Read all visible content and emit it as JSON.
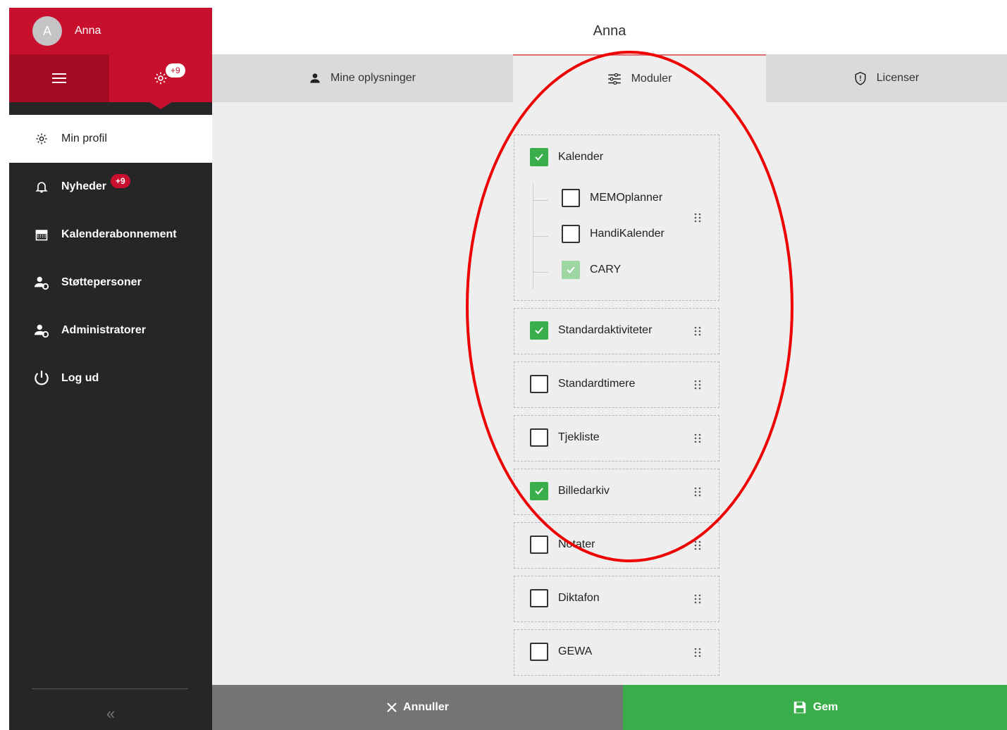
{
  "user": {
    "initial": "A",
    "name": "Anna"
  },
  "header": {
    "settings_badge": "+9",
    "title": "Anna"
  },
  "sidebar": {
    "items": [
      {
        "label": "Min profil",
        "icon": "gear-icon"
      },
      {
        "label": "Nyheder",
        "icon": "bell-icon",
        "badge": "+9"
      },
      {
        "label": "Kalenderabonnement",
        "icon": "calendar-icon"
      },
      {
        "label": "Støttepersoner",
        "icon": "person-gear-icon"
      },
      {
        "label": "Administratorer",
        "icon": "person-gear-icon"
      },
      {
        "label": "Log ud",
        "icon": "power-icon"
      }
    ],
    "collapse_glyph": "«"
  },
  "tabs": [
    {
      "label": "Mine oplysninger",
      "icon": "person-icon"
    },
    {
      "label": "Moduler",
      "icon": "sliders-icon"
    },
    {
      "label": "Licenser",
      "icon": "shield-icon"
    }
  ],
  "modules": {
    "kalender": {
      "label": "Kalender",
      "checked": true,
      "children": [
        {
          "label": "MEMOplanner",
          "checked": false
        },
        {
          "label": "HandiKalender",
          "checked": false
        },
        {
          "label": "CARY",
          "checked": true,
          "disabled": true
        }
      ]
    },
    "list": [
      {
        "label": "Standardaktiviteter",
        "checked": true
      },
      {
        "label": "Standardtimere",
        "checked": false
      },
      {
        "label": "Tjekliste",
        "checked": false
      },
      {
        "label": "Billedarkiv",
        "checked": true
      },
      {
        "label": "Notater",
        "checked": false
      },
      {
        "label": "Diktafon",
        "checked": false
      },
      {
        "label": "GEWA",
        "checked": false
      }
    ]
  },
  "footer": {
    "cancel_label": "Annuller",
    "save_label": "Gem"
  },
  "colors": {
    "brand_red": "#c8102e",
    "dark_red": "#a30a24",
    "sidebar_bg": "#262626",
    "check_green": "#3aae4a",
    "cancel_gray": "#747474",
    "annotation_red": "#ee0000"
  }
}
